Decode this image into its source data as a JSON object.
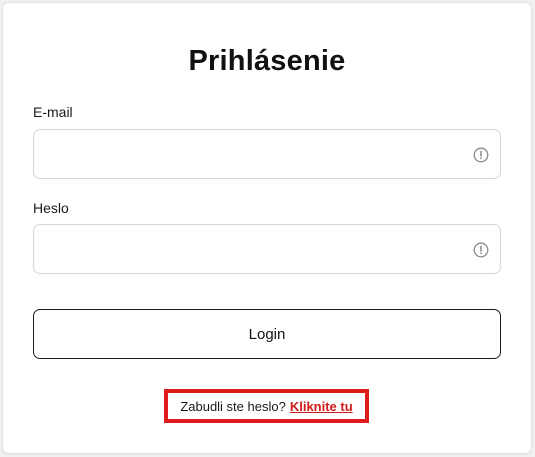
{
  "login": {
    "title": "Prihlásenie",
    "email_label": "E-mail",
    "email_value": "",
    "password_label": "Heslo",
    "password_value": "",
    "login_button": "Login",
    "forgot_text": "Zabudli ste heslo?",
    "forgot_link": "Kliknite tu"
  },
  "icons": {
    "field_status": "alert-circle-icon"
  },
  "colors": {
    "highlight_border": "#e01b1b",
    "link": "#d11a1a",
    "field_border": "#d6d6d6",
    "button_border": "#1a1a1a"
  }
}
